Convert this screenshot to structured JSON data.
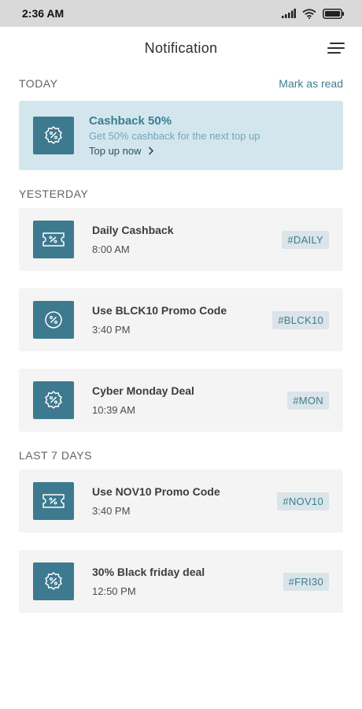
{
  "status_bar": {
    "time": "2:36 AM"
  },
  "header": {
    "title": "Notification",
    "menu_icon": "menu-icon"
  },
  "today": {
    "section_title": "TODAY",
    "mark_as_read": "Mark as read",
    "hero": {
      "icon": "discount-badge-icon",
      "title": "Cashback 50%",
      "subtitle": "Get 50% cashback for the next top up",
      "cta": "Top up now"
    }
  },
  "yesterday": {
    "section_title": "YESTERDAY",
    "items": [
      {
        "icon": "coupon-icon",
        "title": "Daily Cashback",
        "time": "8:00 AM",
        "tag": "#DAILY"
      },
      {
        "icon": "percent-circle-icon",
        "title": "Use BLCK10 Promo Code",
        "time": "3:40 PM",
        "tag": "#BLCK10"
      },
      {
        "icon": "discount-badge-icon",
        "title": "Cyber Monday Deal",
        "time": "10:39 AM",
        "tag": "#MON"
      }
    ]
  },
  "last7": {
    "section_title": "LAST 7 DAYS",
    "items": [
      {
        "icon": "coupon-icon",
        "title": "Use NOV10 Promo Code",
        "time": "3:40 PM",
        "tag": "#NOV10"
      },
      {
        "icon": "discount-badge-icon",
        "title": "30% Black friday deal",
        "time": "12:50 PM",
        "tag": "#FRI30"
      }
    ]
  },
  "colors": {
    "accent": "#3b7d91",
    "icon_bg": "#3d7a8f",
    "hero_bg": "#d3e6ee",
    "card_bg": "#f4f4f4",
    "tag_bg": "#dbe4e8"
  }
}
